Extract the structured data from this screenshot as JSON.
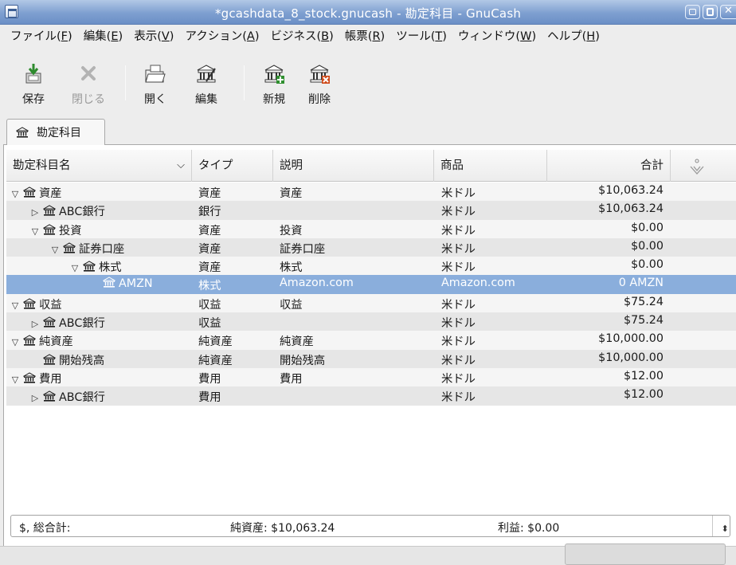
{
  "window": {
    "title": "*gcashdata_8_stock.gnucash - 勘定科目 - GnuCash",
    "app_icon": "gnucash-app-icon"
  },
  "menu": [
    {
      "label": "ファイル(",
      "key": "F",
      "end": ")"
    },
    {
      "label": "編集(",
      "key": "E",
      "end": ")"
    },
    {
      "label": "表示(",
      "key": "V",
      "end": ")"
    },
    {
      "label": "アクション(",
      "key": "A",
      "end": ")"
    },
    {
      "label": "ビジネス(",
      "key": "B",
      "end": ")"
    },
    {
      "label": "帳票(",
      "key": "R",
      "end": ")"
    },
    {
      "label": "ツール(",
      "key": "T",
      "end": ")"
    },
    {
      "label": "ウィンドウ(",
      "key": "W",
      "end": ")"
    },
    {
      "label": "ヘルプ(",
      "key": "H",
      "end": ")"
    }
  ],
  "toolbar": {
    "save": "保存",
    "close": "閉じる",
    "open": "開く",
    "edit": "編集",
    "new": "新規",
    "delete": "削除"
  },
  "tab": {
    "label": "勘定科目"
  },
  "columns": {
    "name": "勘定科目名",
    "type": "タイプ",
    "description": "説明",
    "commodity": "商品",
    "total": "合計"
  },
  "accounts": [
    {
      "name": "資産",
      "depth": 0,
      "expander": "open",
      "type": "資産",
      "description": "資産",
      "commodity": "米ドル",
      "total": "$10,063.24"
    },
    {
      "name": "ABC銀行",
      "depth": 1,
      "expander": "closed",
      "type": "銀行",
      "description": "",
      "commodity": "米ドル",
      "total": "$10,063.24"
    },
    {
      "name": "投資",
      "depth": 1,
      "expander": "open",
      "type": "資産",
      "description": "投資",
      "commodity": "米ドル",
      "total": "$0.00"
    },
    {
      "name": "証券口座",
      "depth": 2,
      "expander": "open",
      "type": "資産",
      "description": "証券口座",
      "commodity": "米ドル",
      "total": "$0.00"
    },
    {
      "name": "株式",
      "depth": 3,
      "expander": "open",
      "type": "資産",
      "description": "株式",
      "commodity": "米ドル",
      "total": "$0.00"
    },
    {
      "name": "AMZN",
      "depth": 4,
      "expander": "none",
      "type": "株式",
      "description": "Amazon.com",
      "commodity": "Amazon.com",
      "total": "0 AMZN",
      "selected": true
    },
    {
      "name": "収益",
      "depth": 0,
      "expander": "open",
      "type": "収益",
      "description": "収益",
      "commodity": "米ドル",
      "total": "$75.24"
    },
    {
      "name": "ABC銀行",
      "depth": 1,
      "expander": "closed",
      "type": "収益",
      "description": "",
      "commodity": "米ドル",
      "total": "$75.24"
    },
    {
      "name": "純資産",
      "depth": 0,
      "expander": "open",
      "type": "純資産",
      "description": "純資産",
      "commodity": "米ドル",
      "total": "$10,000.00"
    },
    {
      "name": "開始残高",
      "depth": 1,
      "expander": "none",
      "type": "純資産",
      "description": "開始残高",
      "commodity": "米ドル",
      "total": "$10,000.00"
    },
    {
      "name": "費用",
      "depth": 0,
      "expander": "open",
      "type": "費用",
      "description": "費用",
      "commodity": "米ドル",
      "total": "$12.00"
    },
    {
      "name": "ABC銀行",
      "depth": 1,
      "expander": "closed",
      "type": "費用",
      "description": "",
      "commodity": "米ドル",
      "total": "$12.00"
    }
  ],
  "summary": {
    "label": "$, 総合計:",
    "net_assets": "純資産: $10,063.24",
    "profit": "利益: $0.00"
  },
  "colors": {
    "selection": "#8aaedc",
    "titlebar": "#7e9fd0"
  }
}
